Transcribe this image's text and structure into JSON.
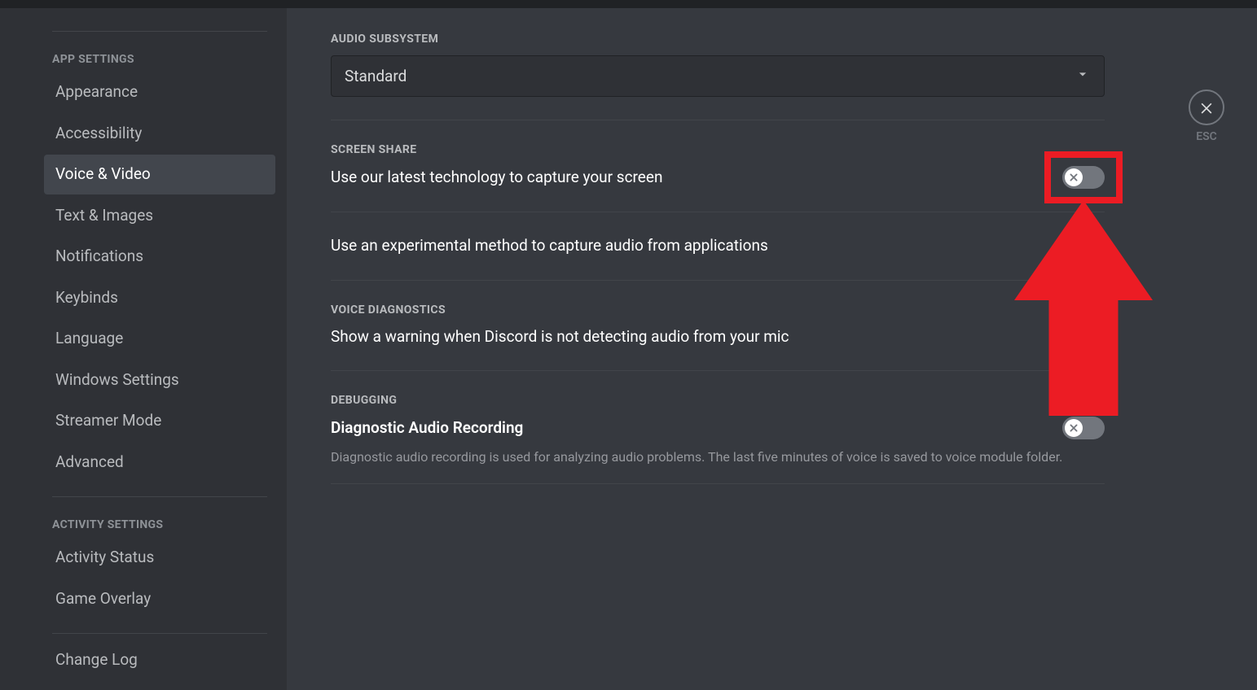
{
  "sidebar": {
    "app_settings_header": "APP SETTINGS",
    "activity_settings_header": "ACTIVITY SETTINGS",
    "items": {
      "appearance": "Appearance",
      "accessibility": "Accessibility",
      "voice_video": "Voice & Video",
      "text_images": "Text & Images",
      "notifications": "Notifications",
      "keybinds": "Keybinds",
      "language": "Language",
      "windows_settings": "Windows Settings",
      "streamer_mode": "Streamer Mode",
      "advanced": "Advanced",
      "activity_status": "Activity Status",
      "game_overlay": "Game Overlay",
      "change_log": "Change Log"
    }
  },
  "close": {
    "label": "ESC"
  },
  "sections": {
    "audio_subsystem": {
      "header": "AUDIO SUBSYSTEM",
      "selected": "Standard"
    },
    "screen_share": {
      "header": "SCREEN SHARE",
      "option1": "Use our latest technology to capture your screen",
      "option2": "Use an experimental method to capture audio from applications"
    },
    "voice_diagnostics": {
      "header": "VOICE DIAGNOSTICS",
      "option1": "Show a warning when Discord is not detecting audio from your mic"
    },
    "debugging": {
      "header": "DEBUGGING",
      "option1_title": "Diagnostic Audio Recording",
      "option1_desc": "Diagnostic audio recording is used for analyzing audio problems. The last five minutes of voice is saved to voice module folder."
    }
  }
}
